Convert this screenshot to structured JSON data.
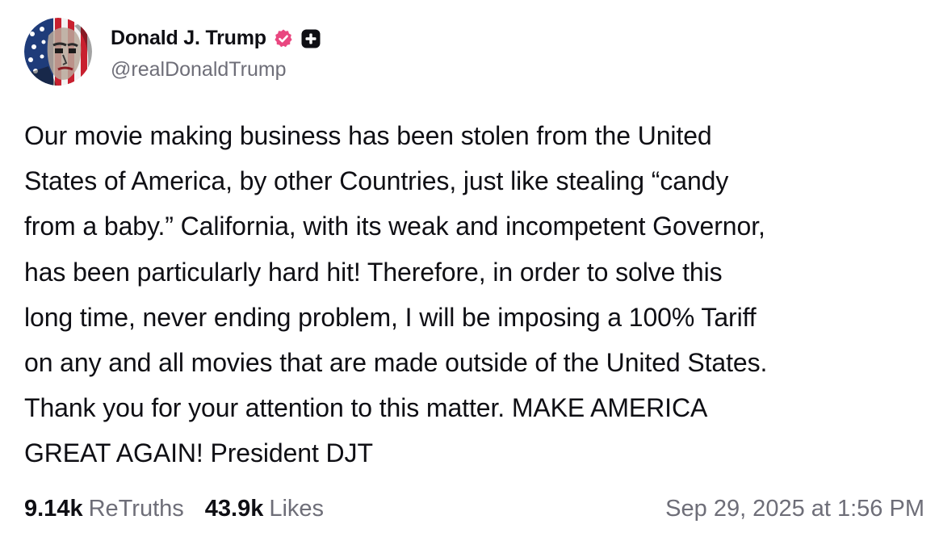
{
  "author": {
    "display_name": "Donald J. Trump",
    "handle": "@realDonaldTrump",
    "avatar_icon": "flag-portrait-avatar",
    "verified_icon": "verified-badge-icon",
    "verified_color": "#e94780",
    "plus_icon": "plus-badge-icon"
  },
  "post": {
    "text": "Our movie making business has been stolen from the United\nStates of America, by other Countries, just like stealing “candy\nfrom a baby.” California, with its weak and incompetent Governor,\nhas been particularly hard hit! Therefore, in order to solve this\nlong time, never ending problem, I will be imposing a 100% Tariff\non any and all movies that are made outside of the United States.\nThank you for your attention to this matter. MAKE AMERICA\nGREAT AGAIN! President DJT"
  },
  "stats": {
    "retruths_count": "9.14k",
    "retruths_label": "ReTruths",
    "likes_count": "43.9k",
    "likes_label": "Likes"
  },
  "timestamp": "Sep 29, 2025 at 1:56 PM",
  "colors": {
    "text_primary": "#0f0f14",
    "text_secondary": "#6e6e78",
    "background": "#ffffff"
  }
}
